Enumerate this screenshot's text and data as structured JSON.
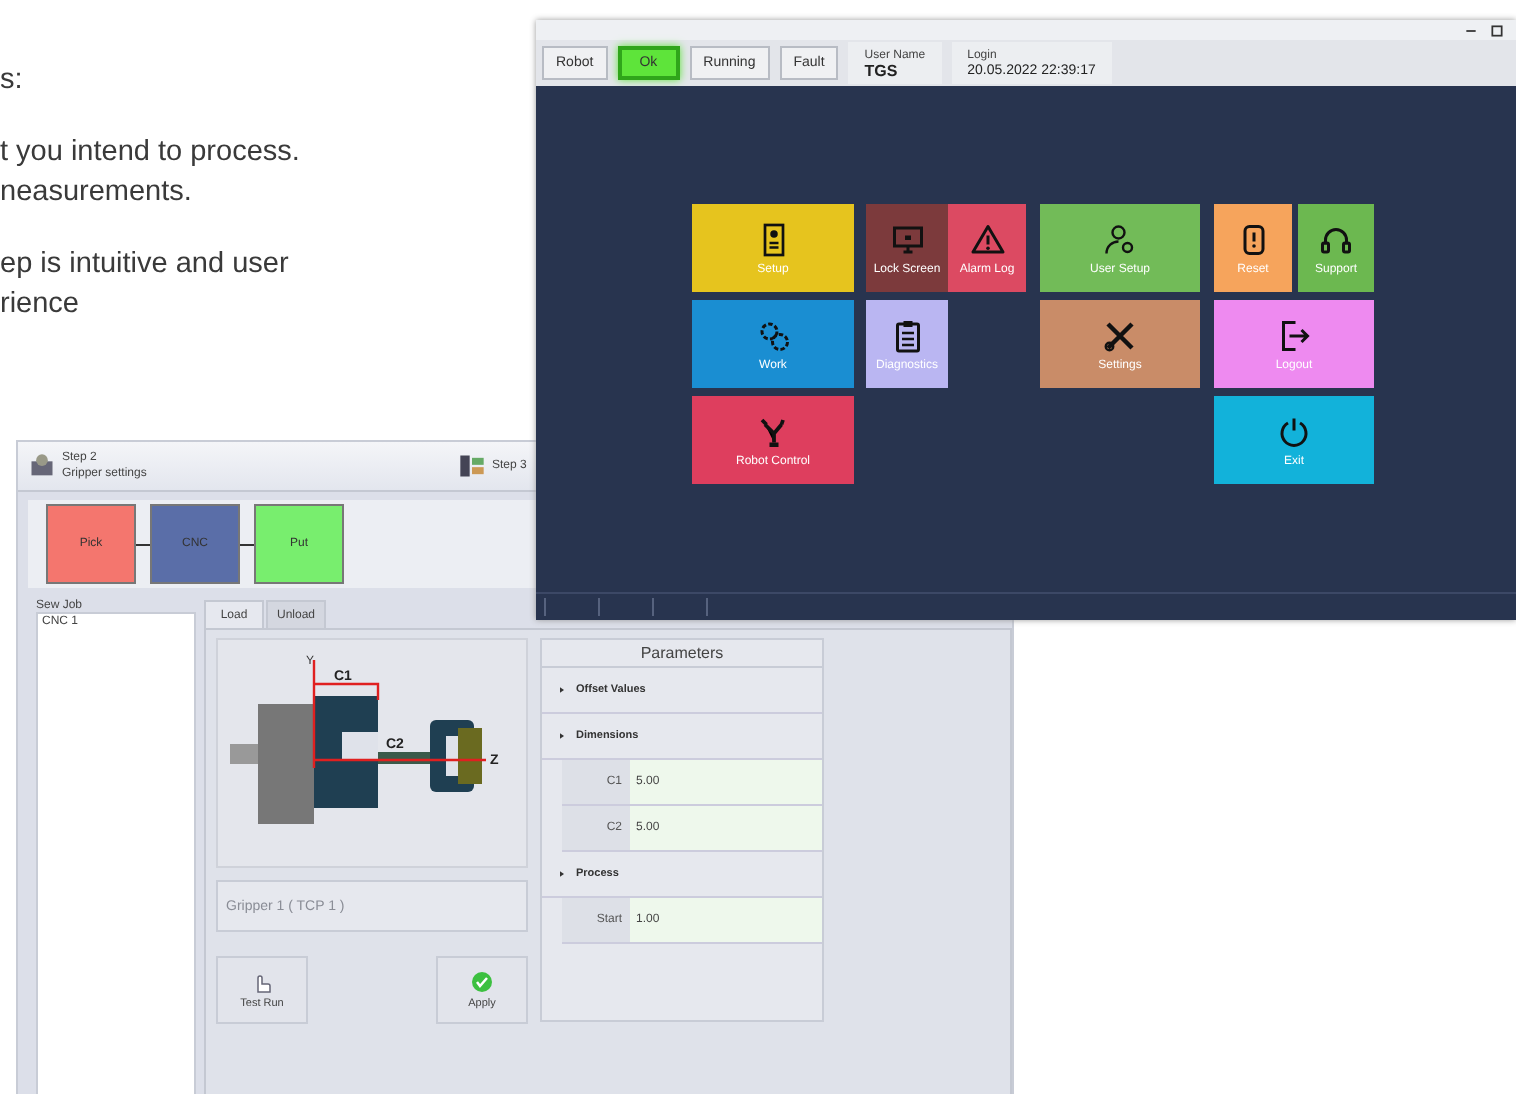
{
  "intro_text": {
    "lines": [
      "s:",
      "t you intend to process.",
      "neasurements.",
      "ep is intuitive and user",
      "rience"
    ]
  },
  "hmi_window": {
    "toolbar": [
      {
        "label": "Robot",
        "selected": false
      },
      {
        "label": "Ok",
        "selected": true
      },
      {
        "label": "Running",
        "selected": false
      },
      {
        "label": "Fault",
        "selected": false
      }
    ],
    "user": {
      "label": "User Name",
      "value": "TGS"
    },
    "login": {
      "label": "Login",
      "value": "20.05.2022 22:39:17"
    },
    "tiles": [
      {
        "label": "Setup",
        "kind": "setup",
        "color": "#e6c41e"
      },
      {
        "label": "Lock Screen",
        "kind": "monitor",
        "color": "#7c3a3c"
      },
      {
        "label": "Alarm Log",
        "kind": "alarm",
        "color": "#dc4a62"
      },
      {
        "label": "User Setup",
        "kind": "user",
        "color": "#72bb58"
      },
      {
        "label": "Reset",
        "kind": "reset",
        "color": "#f6a45c"
      },
      {
        "label": "Support",
        "kind": "headset",
        "color": "#6cb850"
      },
      {
        "label": "Work",
        "kind": "gears",
        "color": "#1a8ed2"
      },
      {
        "label": "Diagnostics",
        "kind": "clipboard",
        "color": "#bab6f2"
      },
      {
        "label": "Settings",
        "kind": "tools",
        "color": "#c98c68"
      },
      {
        "label": "Logout",
        "kind": "logout",
        "color": "#ee8af0"
      },
      {
        "label": "Robot Control",
        "kind": "robot",
        "color": "#de3e5e"
      },
      {
        "label": "Exit",
        "kind": "power",
        "color": "#12b2da"
      }
    ]
  },
  "job_window": {
    "steps": [
      {
        "title": "Step 2",
        "subtitle": "Gripper settings"
      },
      {
        "title": "Step 3"
      }
    ],
    "flow": [
      {
        "label": "Pick",
        "color": "#f4766e"
      },
      {
        "label": "CNC",
        "color": "#5a6ea8"
      },
      {
        "label": "Put",
        "color": "#78ee6e"
      }
    ],
    "job_list": {
      "header": "Sew Job",
      "items": [
        "CNC 1"
      ]
    },
    "tabs": [
      {
        "label": "Load",
        "selected": true
      },
      {
        "label": "Unload",
        "selected": false
      }
    ],
    "diagram_labels": {
      "y_axis": "Y",
      "top_dimension": "C1",
      "middle_dimension": "C2",
      "z_axis": "Z"
    },
    "gripper_field": "Gripper 1 ( TCP 1 )",
    "buttons": [
      {
        "label": "Test Run",
        "kind": "hand"
      },
      {
        "label": "Apply",
        "kind": "check"
      }
    ],
    "parameters": {
      "title": "Parameters",
      "sections": [
        {
          "title": "Offset Values"
        },
        {
          "title": "Dimensions",
          "fields": [
            {
              "label": "C1",
              "value": "5.00"
            },
            {
              "label": "C2",
              "value": "5.00"
            }
          ]
        },
        {
          "title": "Process",
          "fields": [
            {
              "label": "Start",
              "value": "1.00"
            }
          ]
        }
      ]
    }
  }
}
